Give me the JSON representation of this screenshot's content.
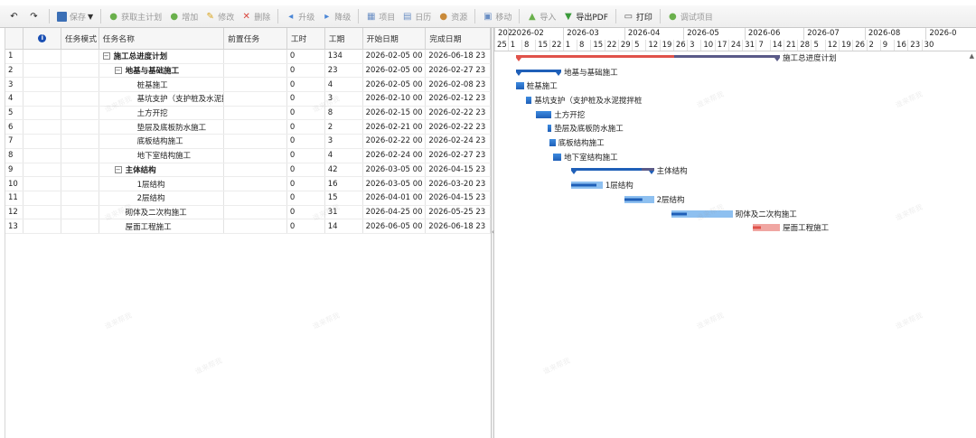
{
  "toolbar": {
    "undo_icon": "↶",
    "redo_icon": "↷",
    "save": "保存",
    "get_master": "获取主计划",
    "add": "增加",
    "edit": "修改",
    "delete": "删除",
    "upgrade": "升级",
    "downgrade": "降级",
    "project": "项目",
    "calendar": "日历",
    "resource": "资源",
    "move": "移动",
    "import": "导入",
    "export_pdf": "导出PDF",
    "print": "打印",
    "debug_project": "调试项目"
  },
  "columns": {
    "info_icon": "i",
    "mode": "任务模式",
    "name": "任务名称",
    "predecessor": "前置任务",
    "work": "工时",
    "duration": "工期",
    "start": "开始日期",
    "end": "完成日期"
  },
  "rows": [
    {
      "no": "1",
      "name": "施工总进度计划",
      "work": "0",
      "duration": "134",
      "start": "2026-02-05 00",
      "end": "2026-06-18 23"
    },
    {
      "no": "2",
      "name": "地基与基础施工",
      "work": "0",
      "duration": "23",
      "start": "2026-02-05 00",
      "end": "2026-02-27 23"
    },
    {
      "no": "3",
      "name": "桩基施工",
      "work": "0",
      "duration": "4",
      "start": "2026-02-05 00",
      "end": "2026-02-08 23"
    },
    {
      "no": "4",
      "name": "基坑支护（支护桩及水泥搅",
      "work": "0",
      "duration": "3",
      "start": "2026-02-10 00",
      "end": "2026-02-12 23"
    },
    {
      "no": "5",
      "name": "土方开挖",
      "work": "0",
      "duration": "8",
      "start": "2026-02-15 00",
      "end": "2026-02-22 23"
    },
    {
      "no": "6",
      "name": "垫层及底板防水施工",
      "work": "0",
      "duration": "2",
      "start": "2026-02-21 00",
      "end": "2026-02-22 23"
    },
    {
      "no": "7",
      "name": "底板结构施工",
      "work": "0",
      "duration": "3",
      "start": "2026-02-22 00",
      "end": "2026-02-24 23"
    },
    {
      "no": "8",
      "name": "地下室结构施工",
      "work": "0",
      "duration": "4",
      "start": "2026-02-24 00",
      "end": "2026-02-27 23"
    },
    {
      "no": "9",
      "name": "主体结构",
      "work": "0",
      "duration": "42",
      "start": "2026-03-05 00",
      "end": "2026-04-15 23"
    },
    {
      "no": "10",
      "name": "1层结构",
      "work": "0",
      "duration": "16",
      "start": "2026-03-05 00",
      "end": "2026-03-20 23"
    },
    {
      "no": "11",
      "name": "2层结构",
      "work": "0",
      "duration": "15",
      "start": "2026-04-01 00",
      "end": "2026-04-15 23"
    },
    {
      "no": "12",
      "name": "砌体及二次构施工",
      "work": "0",
      "duration": "31",
      "start": "2026-04-25 00",
      "end": "2026-05-25 23"
    },
    {
      "no": "13",
      "name": "屋面工程施工",
      "work": "0",
      "duration": "14",
      "start": "2026-06-05 00",
      "end": "2026-06-18 23"
    }
  ],
  "gantt": {
    "header_months": [
      "202",
      "2026-02",
      "2026-03",
      "2026-04",
      "2026-05",
      "2026-06",
      "2026-07",
      "2026-08",
      "2026-0"
    ],
    "header_days": [
      "25",
      "1",
      "8",
      "15",
      "22",
      "1",
      "8",
      "15",
      "22",
      "29",
      "5",
      "12",
      "19",
      "26",
      "3",
      "10",
      "17",
      "24",
      "31",
      "7",
      "14",
      "21",
      "28",
      "5",
      "12",
      "19",
      "26",
      "2",
      "9",
      "16",
      "23",
      "30"
    ],
    "bar_labels": [
      "施工总进度计划",
      "地基与基础施工",
      "桩基施工",
      "基坑支护（支护桩及水泥搅拌桩",
      "土方开挖",
      "垫层及底板防水施工",
      "底板结构施工",
      "地下室结构施工",
      "主体结构",
      "1层结构",
      "2层结构",
      "砌体及二次构施工",
      "屋面工程施工"
    ],
    "colors": {
      "bar": "#3d8be0",
      "bar_dark": "#1f5fb8",
      "summary": "#1f5fb8",
      "critical": "#e0524a",
      "critical_light": "#f0a6a2",
      "summary_tail": "#5a5a88",
      "bar_light": "#8ec0f0"
    },
    "watermark": "谁来帮我"
  }
}
